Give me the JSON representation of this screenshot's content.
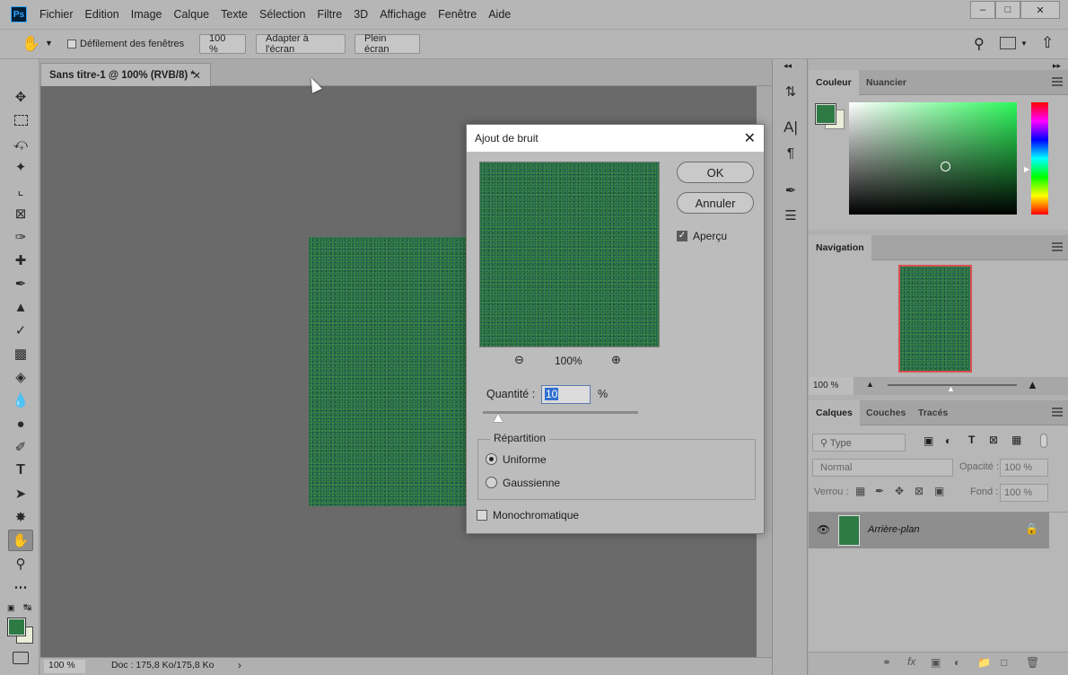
{
  "app": {
    "logo": "Ps"
  },
  "menu": [
    "Fichier",
    "Edition",
    "Image",
    "Calque",
    "Texte",
    "Sélection",
    "Filtre",
    "3D",
    "Affichage",
    "Fenêtre",
    "Aide"
  ],
  "options": {
    "scroll_windows_label": "Défilement des fenêtres",
    "zoom_btn": "100 %",
    "fit_btn": "Adapter à l'écran",
    "full_btn": "Plein écran"
  },
  "document": {
    "tab_title": "Sans titre-1 @ 100% (RVB/8) *",
    "zoom": "100 %",
    "doc_info": "Doc : 175,8 Ko/175,8 Ko",
    "layer_color": "#2e7a45"
  },
  "dialog": {
    "title": "Ajout de bruit",
    "ok": "OK",
    "cancel": "Annuler",
    "preview_label": "Aperçu",
    "preview_checked": true,
    "zoom": "100%",
    "amount_label": "Quantité :",
    "amount_value": "10",
    "amount_unit": "%",
    "amount_slider_fraction": 0.1,
    "distribution_label": "Répartition",
    "uniform_label": "Uniforme",
    "gaussian_label": "Gaussienne",
    "selected_distribution": "Uniforme",
    "mono_label": "Monochromatique",
    "mono_checked": false
  },
  "panels": {
    "color_tabs": [
      "Couleur",
      "Nuancier"
    ],
    "navigator_title": "Navigation",
    "navigator_zoom": "100 %",
    "layers_tabs": [
      "Calques",
      "Couches",
      "Tracés"
    ],
    "filter_placeholder": "Type",
    "blend_mode": "Normal",
    "opacity_label": "Opacité :",
    "opacity_value": "100 %",
    "lock_label": "Verrou :",
    "fill_label": "Fond :",
    "fill_value": "100 %",
    "layer_name": "Arrière-plan",
    "foreground_color": "#2e7a45",
    "background_color": "#e8ecd8"
  }
}
